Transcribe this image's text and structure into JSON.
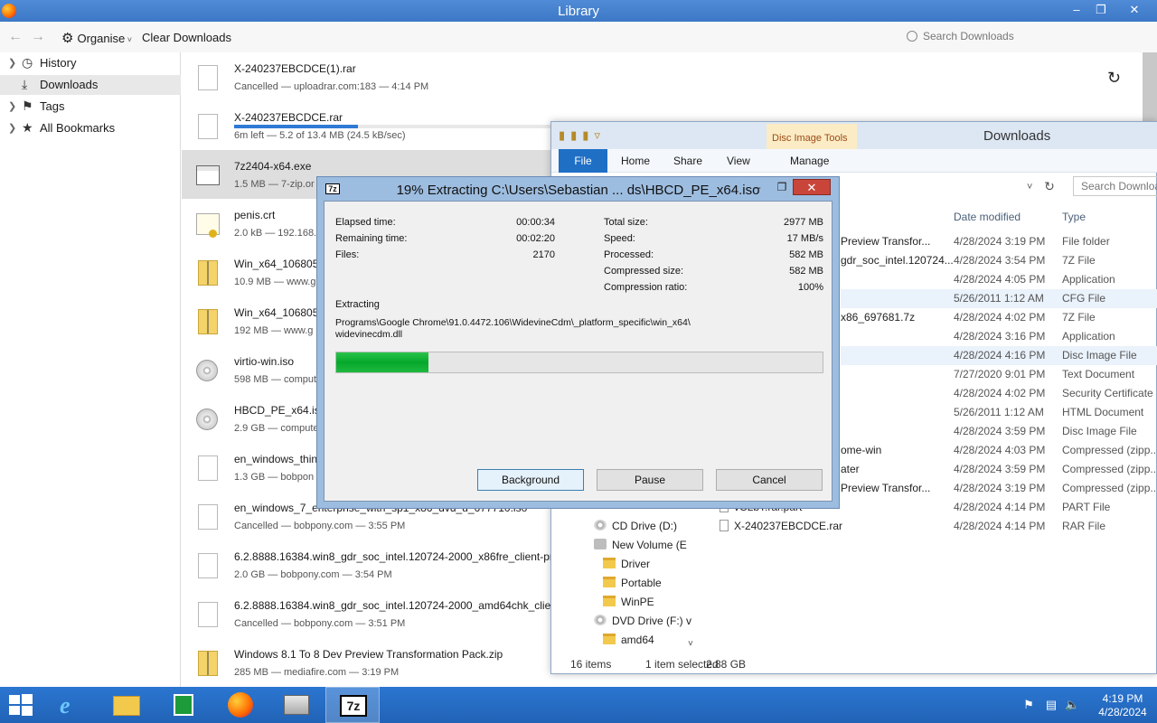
{
  "library": {
    "title": "Library",
    "toolbar": {
      "organise": "Organise",
      "clear": "Clear Downloads",
      "search_placeholder": "Search Downloads"
    },
    "sidebar": [
      "History",
      "Downloads",
      "Tags",
      "All Bookmarks"
    ],
    "downloads": [
      {
        "name": "X-240237EBCDCE(1).rar",
        "status": "Cancelled — uploadrar.com:183 — 4:14 PM",
        "icon": "doc"
      },
      {
        "name": "X-240237EBCDCE.rar",
        "status": "6m left — 5.2 of 13.4 MB (24.5 kB/sec)",
        "icon": "doc",
        "progress": 0.39
      },
      {
        "name": "7z2404-x64.exe",
        "status": "1.5 MB — 7-zip.or",
        "icon": "exe"
      },
      {
        "name": "penis.crt",
        "status": "2.0 kB — 192.168.",
        "icon": "cert"
      },
      {
        "name": "Win_x64_1068050",
        "status": "10.9 MB — www.g",
        "icon": "zip"
      },
      {
        "name": "Win_x64_1068050",
        "status": "192 MB — www.g",
        "icon": "zip"
      },
      {
        "name": "virtio-win.iso",
        "status": "598 MB — comput",
        "icon": "disc"
      },
      {
        "name": "HBCD_PE_x64.iso",
        "status": "2.9 GB — compute",
        "icon": "disc"
      },
      {
        "name": "en_windows_thin",
        "status": "1.3 GB — bobpon",
        "icon": "doc"
      },
      {
        "name": "en_windows_7_enterprise_with_sp1_x86_dvd_u_677710.iso",
        "status": "Cancelled — bobpony.com — 3:55 PM",
        "icon": "doc"
      },
      {
        "name": "6.2.8888.16384.win8_gdr_soc_intel.120724-2000_x86fre_client-profes",
        "status": "2.0 GB — bobpony.com — 3:54 PM",
        "icon": "doc"
      },
      {
        "name": "6.2.8888.16384.win8_gdr_soc_intel.120724-2000_amd64chk_client-p",
        "status": "Cancelled — bobpony.com — 3:51 PM",
        "icon": "doc"
      },
      {
        "name": "Windows 8.1 To 8 Dev Preview Transformation Pack.zip",
        "status": "285 MB — mediafire.com — 3:19 PM",
        "icon": "zip"
      }
    ]
  },
  "explorer": {
    "title": "Downloads",
    "contextual_tab": "Disc Image Tools",
    "tabs": [
      "File",
      "Home",
      "Share",
      "View",
      "Manage"
    ],
    "search_placeholder": "Search Downloads",
    "columns": {
      "date": "Date modified",
      "type": "Type"
    },
    "rows": [
      {
        "name": "Preview Transfor...",
        "date": "4/28/2024 3:19 PM",
        "type": "File folder"
      },
      {
        "name": "gdr_soc_intel.120724...",
        "date": "4/28/2024 3:54 PM",
        "type": "7Z File"
      },
      {
        "name": "",
        "date": "4/28/2024 4:05 PM",
        "type": "Application"
      },
      {
        "name": "",
        "date": "5/26/2011 1:12 AM",
        "type": "CFG File"
      },
      {
        "name": "x86_697681.7z",
        "date": "4/28/2024 4:02 PM",
        "type": "7Z File"
      },
      {
        "name": "",
        "date": "4/28/2024 3:16 PM",
        "type": "Application"
      },
      {
        "name": "",
        "date": "4/28/2024 4:16 PM",
        "type": "Disc Image File"
      },
      {
        "name": "",
        "date": "7/27/2020 9:01 PM",
        "type": "Text Document"
      },
      {
        "name": "",
        "date": "4/28/2024 4:02 PM",
        "type": "Security Certificate"
      },
      {
        "name": "",
        "date": "5/26/2011 1:12 AM",
        "type": "HTML Document"
      },
      {
        "name": "",
        "date": "4/28/2024 3:59 PM",
        "type": "Disc Image File"
      },
      {
        "name": "ome-win",
        "date": "4/28/2024 4:03 PM",
        "type": "Compressed (zipp..."
      },
      {
        "name": "ater",
        "date": "4/28/2024 3:59 PM",
        "type": "Compressed (zipp..."
      },
      {
        "name": "Preview Transfor...",
        "date": "4/28/2024 3:19 PM",
        "type": "Compressed (zipp..."
      },
      {
        "name": "",
        "date": "4/28/2024 4:14 PM",
        "type": "PART File"
      },
      {
        "name": "",
        "date": "4/28/2024 4:14 PM",
        "type": "RAR File"
      }
    ],
    "files_visible": {
      "part": "vCLbT.rar.part",
      "rar": "X-240237EBCDCE.rar"
    },
    "nav": [
      "CD Drive (D:)",
      "New Volume (E",
      "Driver",
      "Portable",
      "WinPE",
      "DVD Drive (F:) v",
      "amd64"
    ],
    "status": {
      "count": "16 items",
      "selected": "1 item selected",
      "size": "2.88 GB"
    }
  },
  "zip": {
    "title": "19% Extracting C:\\Users\\Sebastian ... ds\\HBCD_PE_x64.iso",
    "progress_percent": 19,
    "left": [
      {
        "label": "Elapsed time:",
        "value": "00:00:34"
      },
      {
        "label": "Remaining time:",
        "value": "00:02:20"
      },
      {
        "label": "Files:",
        "value": "2170"
      }
    ],
    "right": [
      {
        "label": "Total size:",
        "value": "2977 MB"
      },
      {
        "label": "Speed:",
        "value": "17 MB/s"
      },
      {
        "label": "Processed:",
        "value": "582 MB"
      },
      {
        "label": "Compressed size:",
        "value": "582 MB"
      },
      {
        "label": "Compression ratio:",
        "value": "100%"
      }
    ],
    "extracting_label": "Extracting",
    "path_line1": "Programs\\Google Chrome\\91.0.4472.106\\WidevineCdm\\_platform_specific\\win_x64\\",
    "path_line2": "widevinecdm.dll",
    "buttons": {
      "background": "Background",
      "pause": "Pause",
      "cancel": "Cancel"
    }
  },
  "taskbar": {
    "time": "4:19 PM",
    "date": "4/28/2024"
  },
  "colors": {
    "accent": "#1f6fc5",
    "progress_green": "#06a82c",
    "taskbar": "#2163b6"
  }
}
